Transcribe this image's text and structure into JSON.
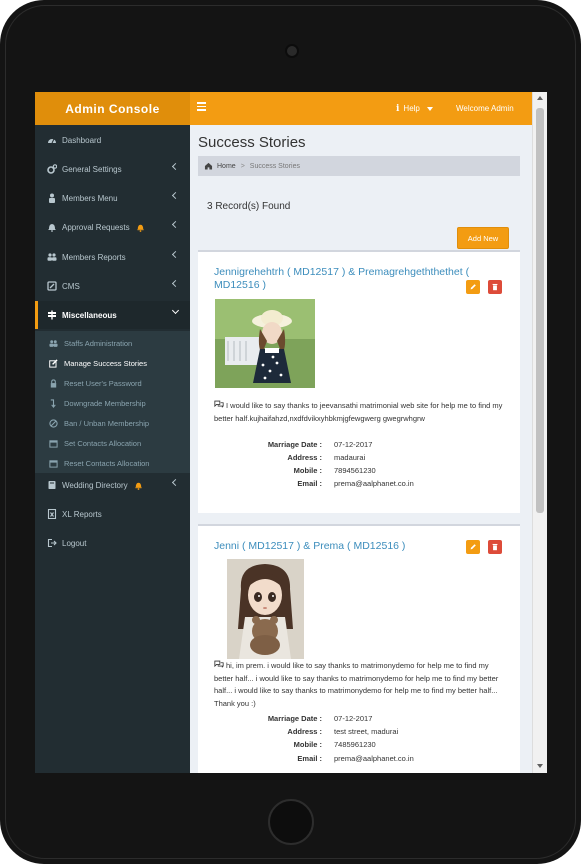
{
  "header": {
    "logo": "Admin Console",
    "help_label": "Help",
    "welcome": "Welcome Admin"
  },
  "sidebar": {
    "items": [
      {
        "label": "Dashboard",
        "icon": "dashboard-icon"
      },
      {
        "label": "General Settings",
        "icon": "cogs-icon"
      },
      {
        "label": "Members Menu",
        "icon": "user-lock-icon"
      },
      {
        "label": "Approval Requests",
        "icon": "bell-icon"
      },
      {
        "label": "Members Reports",
        "icon": "users-icon"
      },
      {
        "label": "CMS",
        "icon": "cms-icon"
      },
      {
        "label": "Miscellaneous",
        "icon": "signpost-icon"
      }
    ],
    "submenu": [
      {
        "label": "Staffs Administration",
        "icon": "users-icon"
      },
      {
        "label": "Manage Success Stories",
        "icon": "edit-icon"
      },
      {
        "label": "Reset User's Password",
        "icon": "lock-icon"
      },
      {
        "label": "Downgrade Membership",
        "icon": "level-down-icon"
      },
      {
        "label": "Ban / Unban Membership",
        "icon": "ban-icon"
      },
      {
        "label": "Set Contacts Allocation",
        "icon": "calendar-icon"
      },
      {
        "label": "Reset Contacts Allocation",
        "icon": "calendar-icon"
      }
    ],
    "bottom_items": [
      {
        "label": "Wedding Directory",
        "icon": "book-icon"
      },
      {
        "label": "XL Reports",
        "icon": "excel-icon"
      },
      {
        "label": "Logout",
        "icon": "logout-icon"
      }
    ]
  },
  "page": {
    "title": "Success Stories",
    "breadcrumb_home": "Home",
    "breadcrumb_current": "Success Stories",
    "records_found": "3 Record(s) Found",
    "add_new": "Add New"
  },
  "detail_labels": {
    "marriage_date": "Marriage Date :",
    "address": "Address :",
    "mobile": "Mobile :",
    "email": "Email :"
  },
  "stories": [
    {
      "title": "Jennigrehehtrh ( MD12517 ) & Premagrehgeththethet ( MD12516 )",
      "story": "I would like to say thanks to jeevansathi matrimonial web site for help me to find my better half.kujhaifahzd,nxdfdvikxyhbkmjgfewgwerg gwegrwhgrw",
      "marriage_date": "07-12-2017",
      "address": "madaurai",
      "mobile": "7894561230",
      "email": "prema@aalphanet.co.in"
    },
    {
      "title": "Jenni ( MD12517 ) & Prema ( MD12516 )",
      "story": "hi, im prem. i would like to say thanks to matrimonydemo for help me to find my better half... i would like to say thanks to matrimonydemo for help me to find my better half... i would like to say thanks to matrimonydemo for help me to find my better half... Thank you :)",
      "marriage_date": "07-12-2017",
      "address": "test street, madurai",
      "mobile": "7485961230",
      "email": "prema@aalphanet.co.in"
    }
  ]
}
